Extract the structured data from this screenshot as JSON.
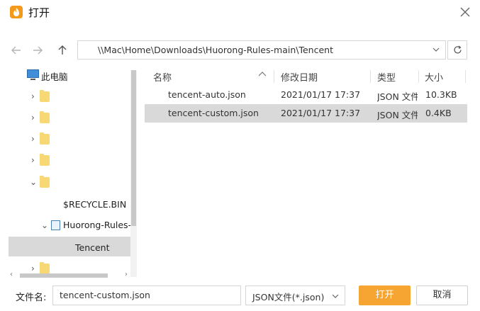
{
  "window": {
    "title": "打开",
    "accent_color": "#f39a1c"
  },
  "nav": {
    "back_icon": "arrow-left-icon",
    "forward_icon": "arrow-right-icon",
    "up_icon": "arrow-up-icon",
    "address": "\\\\Mac\\Home\\Downloads\\Huorong-Rules-main\\Tencent",
    "refresh_icon": "refresh-icon"
  },
  "tree": {
    "this_pc": "此电脑",
    "folders": [
      "",
      "",
      "",
      "",
      ""
    ],
    "recycle": "$RECYCLE.BIN",
    "huorong": "Huorong-Rules-",
    "tencent": "Tencent",
    "last_folder": ""
  },
  "list": {
    "columns": {
      "name": "名称",
      "date": "修改日期",
      "type": "类型",
      "size": "大小"
    },
    "rows": [
      {
        "name": "tencent-auto.json",
        "date": "2021/01/17 17:37",
        "type": "JSON 文件",
        "size": "10.3KB",
        "selected": false
      },
      {
        "name": "tencent-custom.json",
        "date": "2021/01/17 17:37",
        "type": "JSON 文件",
        "size": "0.4KB",
        "selected": true
      }
    ]
  },
  "footer": {
    "filename_label": "文件名:",
    "filename_value": "tencent-custom.json",
    "filetype": "JSON文件(*.json)",
    "open_label": "打开",
    "cancel_label": "取消",
    "open_color": "#f6a532"
  }
}
